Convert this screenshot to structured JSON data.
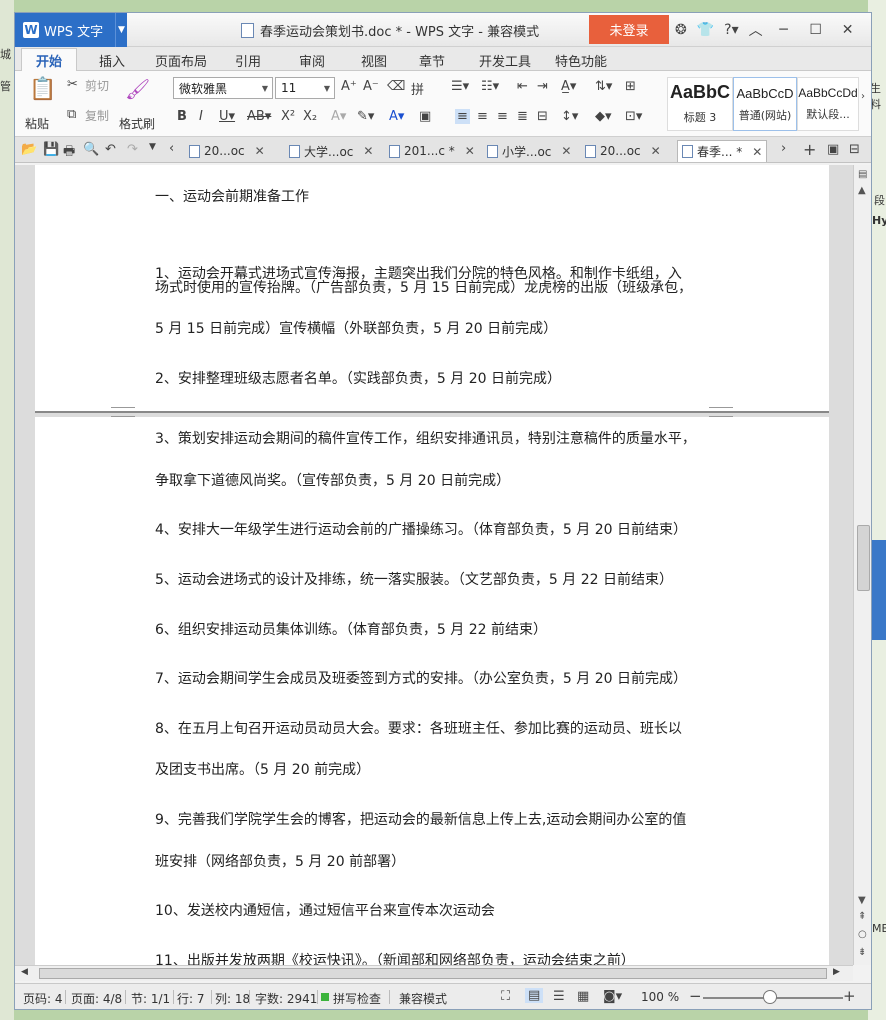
{
  "app": {
    "name": "WPS 文字",
    "window_title": "春季运动会策划书.doc * - WPS 文字 - 兼容模式",
    "login": "未登录"
  },
  "ribbon_tabs": [
    "开始",
    "插入",
    "页面布局",
    "引用",
    "审阅",
    "视图",
    "章节",
    "开发工具",
    "特色功能"
  ],
  "ribbon": {
    "paste": "粘贴",
    "cut": "剪切",
    "copy": "复制",
    "format_painter": "格式刷",
    "font_name": "微软雅黑",
    "font_size": "11",
    "styles": [
      {
        "preview": "AaBbC",
        "label": "标题 3"
      },
      {
        "preview": "AaBbCcD",
        "label": "普通(网站)"
      },
      {
        "preview": "AaBbCcDd",
        "label": "默认段..."
      }
    ]
  },
  "doc_tabs": [
    "20...oc",
    "大学...oc",
    "201...c *",
    "小学...oc",
    "20...oc",
    "春季... *"
  ],
  "document": {
    "paragraphs": [
      "一、运动会前期准备工作",
      "1、运动会开幕式进场式宣传海报，主题突出我们分院的特色风格。和制作卡纸组，入",
      "场式时使用的宣传抬牌。（广告部负责，5 月 15 日前完成）龙虎榜的出版（班级承包，",
      "5 月 15 日前完成）宣传横幅（外联部负责，5 月 20 日前完成）",
      "2、安排整理班级志愿者名单。（实践部负责，5 月 20 日前完成）",
      "3、策划安排运动会期间的稿件宣传工作，组织安排通讯员，特别注意稿件的质量水平，",
      "争取拿下道德风尚奖。（宣传部负责，5 月 20 日前完成）",
      "4、安排大一年级学生进行运动会前的广播操练习。（体育部负责，5 月 20 日前结束）",
      "5、运动会进场式的设计及排练，统一落实服装。（文艺部负责，5 月 22 日前结束）",
      "6、组织安排运动员集体训练。（体育部负责，5 月 22 前结束）",
      "7、运动会期间学生会成员及班委签到方式的安排。（办公室负责，5 月 20 日前完成）",
      "8、在五月上旬召开运动员动员大会。要求：各班班主任、参加比赛的运动员、班长以",
      "及团支书出席。（5 月 20 前完成）",
      "9、完善我们学院学生会的博客，把运动会的最新信息上传上去,运动会期间办公室的值",
      "班安排（网络部负责，5 月 20 前部署）",
      "10、发送校内通短信，通过短信平台来宣传本次运动会",
      "11、出版并发放两期《校运快讯》。（新闻部和网络部负责，运动会结束之前）"
    ]
  },
  "status": {
    "page_code": "页码: 4",
    "page": "页面: 4/8",
    "section": "节: 1/1",
    "row": "行: 7",
    "col": "列: 18",
    "word_count": "字数: 2941",
    "spell_check": "拼写检查",
    "compat_mode": "兼容模式",
    "zoom": "100 %"
  },
  "background_text": {
    "left_top": "城",
    "left_mid": "管",
    "right_1": "生料",
    "right_2": "段",
    "right_3": "Hy",
    "right_4": "MB"
  }
}
